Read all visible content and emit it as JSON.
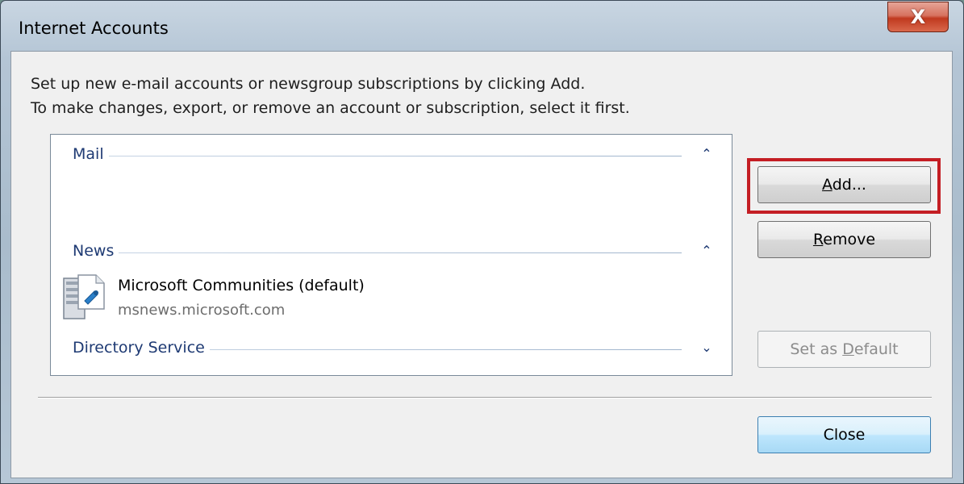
{
  "window": {
    "title": "Internet Accounts",
    "close_glyph": "X"
  },
  "description": {
    "line1": "Set up new e-mail accounts or newsgroup subscriptions by clicking Add.",
    "line2": "To make changes, export, or remove an account or subscription, select it first."
  },
  "groups": [
    {
      "label": "Mail",
      "chevron": "⌃",
      "chevron_icon": "chevron-up-icon"
    },
    {
      "label": "News",
      "chevron": "⌃",
      "chevron_icon": "chevron-up-icon"
    },
    {
      "label": "Directory Service",
      "chevron": "⌄",
      "chevron_icon": "chevron-down-icon"
    }
  ],
  "accounts": [
    {
      "name": "Microsoft Communities (default)",
      "server": "msnews.microsoft.com",
      "icon": "news-server-icon"
    }
  ],
  "buttons": {
    "add": {
      "underline": "A",
      "rest": "dd..."
    },
    "remove": {
      "underline": "R",
      "rest": "emove"
    },
    "set_default": {
      "prefix": "Set as ",
      "underline": "D",
      "rest": "efault"
    },
    "close": "Close"
  },
  "colors": {
    "highlight": "#c41e24",
    "group_label": "#1e3a73",
    "close_button_red": "#c0391f"
  }
}
